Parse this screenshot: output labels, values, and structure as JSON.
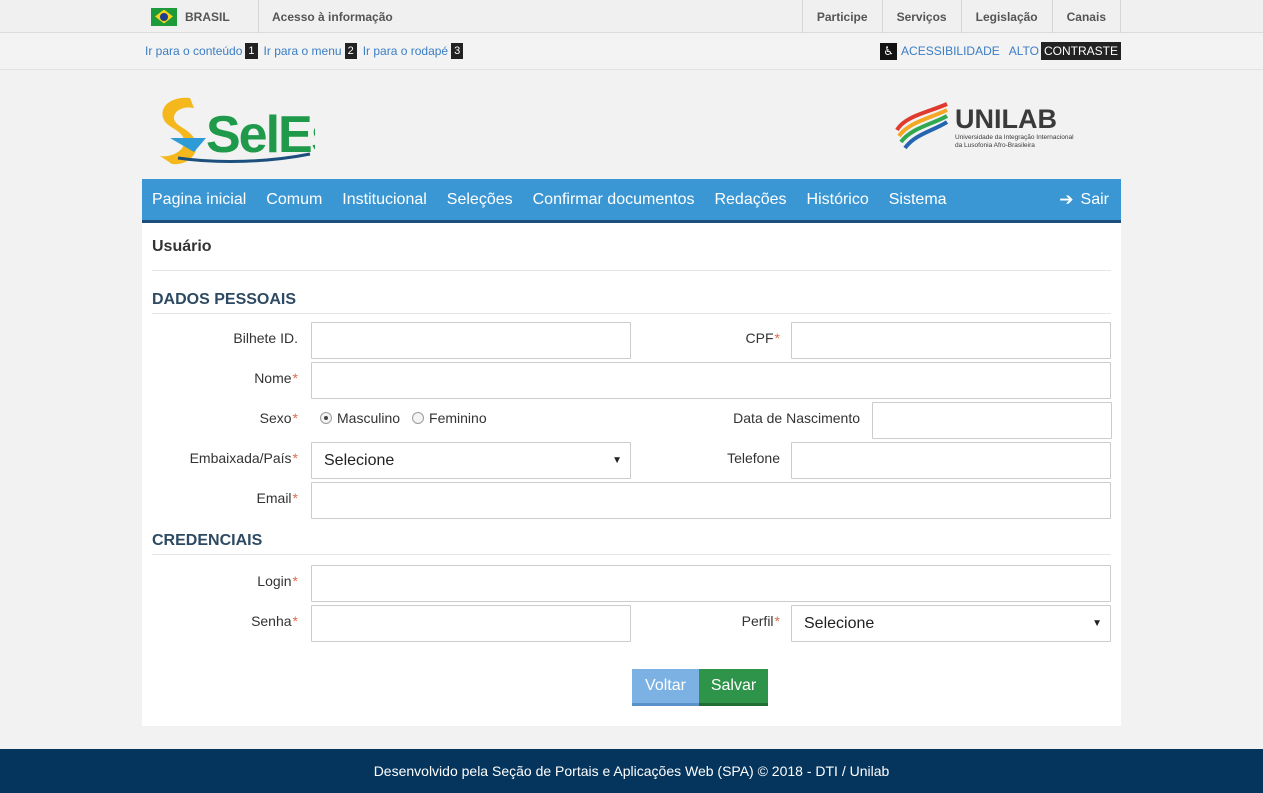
{
  "govbar": {
    "country": "BRASIL",
    "acesso": "Acesso à informação",
    "links": [
      "Participe",
      "Serviços",
      "Legislação",
      "Canais"
    ]
  },
  "accbar": {
    "skip": [
      {
        "label": "Ir para o conteúdo",
        "num": "1"
      },
      {
        "label": "Ir para o menu",
        "num": "2"
      },
      {
        "label": "Ir para o rodapé",
        "num": "3"
      }
    ],
    "acessibilidade": "ACESSIBILIDADE",
    "alto": "ALTO",
    "contraste": "CONTRASTE"
  },
  "header": {
    "logo_text": "SelEst",
    "partner_logo": "UNILAB",
    "partner_sub1": "Universidade da Integração Internacional",
    "partner_sub2": "da Lusofonia Afro-Brasileira"
  },
  "nav": {
    "items": [
      "Pagina inicial",
      "Comum",
      "Institucional",
      "Seleções",
      "Confirmar documentos",
      "Redações",
      "Histórico",
      "Sistema"
    ],
    "logout": "Sair"
  },
  "page": {
    "title": "Usuário",
    "section_personal": "DADOS PESSOAIS",
    "section_credentials": "CREDENCIAIS",
    "fields": {
      "bilhete": "Bilhete ID.",
      "cpf": "CPF",
      "nome": "Nome",
      "sexo": "Sexo",
      "masculino": "Masculino",
      "feminino": "Feminino",
      "nascimento": "Data de Nascimento",
      "embaixada": "Embaixada/País",
      "embaixada_value": "Selecione",
      "telefone": "Telefone",
      "email": "Email",
      "login": "Login",
      "senha": "Senha",
      "perfil": "Perfil",
      "perfil_value": "Selecione"
    },
    "required_mark": "*",
    "buttons": {
      "back": "Voltar",
      "save": "Salvar"
    }
  },
  "footer": {
    "text": "Desenvolvido pela Seção de Portais e Aplicações Web (SPA) © 2018 - DTI / Unilab"
  },
  "colors": {
    "nav_bg": "#3a97d4",
    "footer_bg": "#05355c",
    "save_bg": "#2e9449",
    "back_bg": "#7cb1e3"
  }
}
